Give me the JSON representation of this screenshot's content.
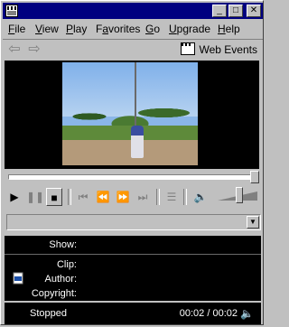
{
  "menu": [
    "File",
    "View",
    "Play",
    "Favorites",
    "Go",
    "Upgrade",
    "Help"
  ],
  "menu_mnemonics": [
    "F",
    "V",
    "P",
    "a",
    "G",
    "U",
    "H"
  ],
  "toolbar": {
    "web_events_label": "Web Events"
  },
  "info": {
    "show_label": "Show:",
    "clip_label": "Clip:",
    "author_label": "Author:",
    "copyright_label": "Copyright:"
  },
  "status": {
    "state": "Stopped",
    "time": "00:02 / 00:02"
  },
  "colors": {
    "titlebar": "#000080",
    "panel": "#c0c0c0",
    "info_bg": "#000000"
  }
}
